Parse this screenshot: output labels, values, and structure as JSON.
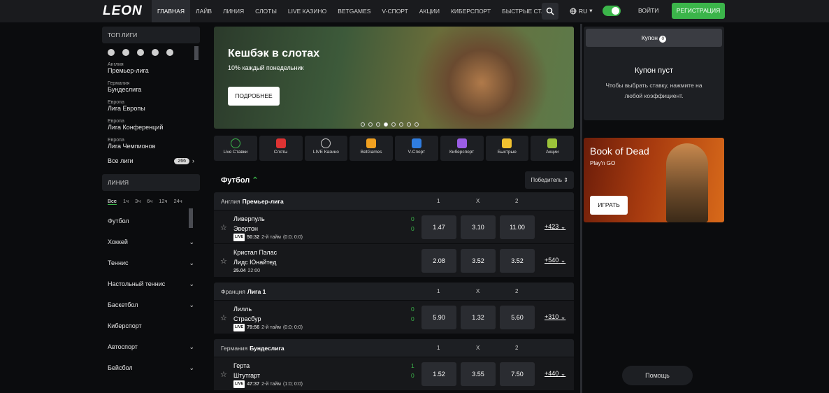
{
  "header": {
    "logo": "LEON",
    "nav": [
      "ГЛАВНАЯ",
      "ЛАЙВ",
      "ЛИНИЯ",
      "СЛОТЫ",
      "LIVE КАЗИНО",
      "BETGAMES",
      "V-СПОРТ",
      "АКЦИИ",
      "КИБЕРСПОРТ",
      "БЫСТРЫЕ СТАВКИ"
    ],
    "lang": "RU",
    "login": "ВОЙТИ",
    "register": "РЕГИСТРАЦИЯ"
  },
  "sidebar": {
    "top_leagues_title": "ТОП ЛИГИ",
    "leagues": [
      {
        "country": "Англия",
        "name": "Премьер-лига"
      },
      {
        "country": "Германия",
        "name": "Бундеслига"
      },
      {
        "country": "Европа",
        "name": "Лига Европы"
      },
      {
        "country": "Европа",
        "name": "Лига Конференций"
      },
      {
        "country": "Европа",
        "name": "Лига Чемпионов"
      }
    ],
    "all_leagues": "Все лиги",
    "all_leagues_count": "266",
    "line_title": "ЛИНИЯ",
    "time_filters": [
      "Все",
      "1ч",
      "3ч",
      "6ч",
      "12ч",
      "24ч"
    ],
    "sports": [
      "Футбол",
      "Хоккей",
      "Теннис",
      "Настольный теннис",
      "Баскетбол",
      "Киберспорт",
      "Автоспорт",
      "Бейсбол"
    ]
  },
  "banner": {
    "title": "Кешбэк в слотах",
    "subtitle": "10% каждый понедельник",
    "button": "ПОДРОБНЕЕ"
  },
  "categories": [
    "Live Ставки",
    "Слоты",
    "LIVE Казино",
    "BetGames",
    "V-Спорт",
    "Киберспорт",
    "Быстрые",
    "Акции"
  ],
  "section": {
    "title": "Футбол",
    "market": "Победитель"
  },
  "odds_headers": [
    "1",
    "X",
    "2"
  ],
  "leagues": [
    {
      "country": "Англия",
      "name": "Премьер-лига",
      "matches": [
        {
          "home": "Ливерпуль",
          "away": "Эвертон",
          "score_home": "0",
          "score_away": "0",
          "live": "LIVE",
          "time": "50:32",
          "period": "2-й тайм",
          "detail": "(0:0; 0:0)",
          "odds": [
            "1.47",
            "3.10",
            "11.00"
          ],
          "more": "+423"
        },
        {
          "home": "Кристал Пэлас",
          "away": "Лидс Юнайтед",
          "score_home": "",
          "score_away": "",
          "live": "",
          "time": "25.04",
          "period": "22:00",
          "detail": "",
          "odds": [
            "2.08",
            "3.52",
            "3.52"
          ],
          "more": "+540"
        }
      ]
    },
    {
      "country": "Франция",
      "name": "Лига 1",
      "matches": [
        {
          "home": "Лилль",
          "away": "Страсбур",
          "score_home": "0",
          "score_away": "0",
          "live": "LIVE",
          "time": "79:56",
          "period": "2-й тайм",
          "detail": "(0:0; 0:0)",
          "odds": [
            "5.90",
            "1.32",
            "5.60"
          ],
          "more": "+310"
        }
      ]
    },
    {
      "country": "Германия",
      "name": "Бундеслига",
      "matches": [
        {
          "home": "Герта",
          "away": "Штутгарт",
          "score_home": "1",
          "score_away": "0",
          "live": "LIVE",
          "time": "47:37",
          "period": "2-й тайм",
          "detail": "(1:0; 0:0)",
          "odds": [
            "1.52",
            "3.55",
            "7.50"
          ],
          "more": "+440"
        }
      ]
    }
  ],
  "coupon": {
    "tab": "Купон",
    "count": "0",
    "empty_title": "Купон пуст",
    "empty_desc": "Чтобы выбрать ставку, нажмите на любой коэффициент."
  },
  "promo": {
    "title": "Book of Dead",
    "provider": "Play'n GO",
    "button": "ИГРАТЬ"
  },
  "help": "Помощь"
}
